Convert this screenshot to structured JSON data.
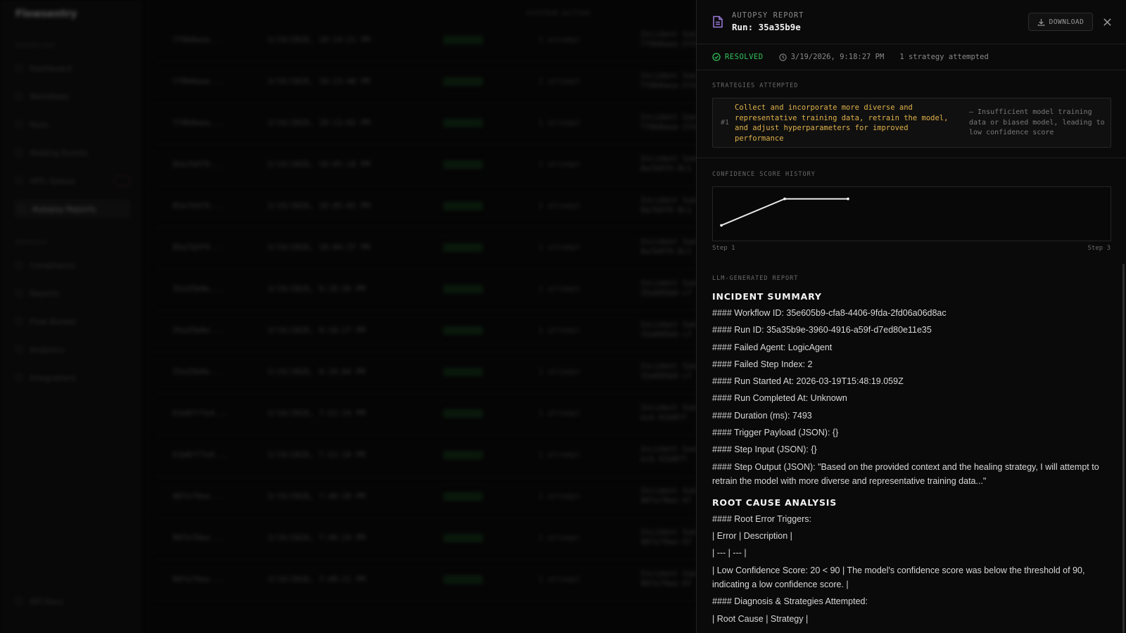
{
  "background": {
    "brand": "Flowsentry",
    "topbar": "SYSTEM ACTIVE",
    "sections": [
      "WORKFLOW",
      "ANALYSIS"
    ],
    "nav": [
      "Dashboard",
      "Workflows",
      "Runs",
      "Healing Events",
      "HITL Queue",
      "Autopsy Reports",
      "Compliance",
      "Reports",
      "Flow Builder",
      "Analytics",
      "Integrations"
    ],
    "footer": "API Docs",
    "rows": [
      {
        "id": "7f8b0aea...",
        "time": "3/19/2026, 10:14:21 PM",
        "attempts": "1 attempt",
        "detail1": "Incident Sum",
        "detail2": "7f8b0aea-2f4"
      },
      {
        "id": "7f8b0aea...",
        "time": "3/19/2026, 10:13:48 PM",
        "attempts": "1 attempt",
        "detail1": "Incident Sum",
        "detail2": "7f8b0aea-2f4"
      },
      {
        "id": "7f8b0aea...",
        "time": "3/19/2026, 10:13:02 PM",
        "attempts": "1 attempt",
        "detail1": "Incident Sum",
        "detail2": "7f8b0aea-2f4"
      },
      {
        "id": "85a7b9f9...",
        "time": "3/19/2026, 10:05:18 PM",
        "attempts": "1 attempt",
        "detail1": "Incident Sum",
        "detail2": "8a7b9f9-8c1"
      },
      {
        "id": "85a7b9f9...",
        "time": "3/19/2026, 10:05:02 PM",
        "attempts": "1 attempt",
        "detail1": "Incident Sum",
        "detail2": "8a7b9f9-8c1"
      },
      {
        "id": "85a7b9f9...",
        "time": "3/19/2026, 10:04:37 PM",
        "attempts": "1 attempt",
        "detail1": "Incident Sum",
        "detail2": "8a7b9f9-8c1"
      },
      {
        "id": "35a35b9e...",
        "time": "3/19/2026, 9:18:56 PM",
        "attempts": "1 attempt",
        "detail1": "Incident Sum",
        "detail2": "35e605b9-cf"
      },
      {
        "id": "35a35b9e...",
        "time": "3/19/2026, 9:18:27 PM",
        "attempts": "1 attempt",
        "detail1": "Incident Sum",
        "detail2": "35e605b9-cf"
      },
      {
        "id": "35a35b9e...",
        "time": "3/19/2026, 9:18:04 PM",
        "attempts": "1 attempt",
        "detail1": "Incident Sum",
        "detail2": "35e605b9-cf"
      },
      {
        "id": "61b8ff7e4...",
        "time": "3/19/2026, 7:52:14 PM",
        "attempts": "1 attempt",
        "detail1": "Incident Sum",
        "detail2": "ecb-61b8ff"
      },
      {
        "id": "61b8ff7e4...",
        "time": "3/19/2026, 7:52:18 PM",
        "attempts": "1 attempt",
        "detail1": "Incident Sum",
        "detail2": "ecb-61b8ff"
      },
      {
        "id": "907e79ee...",
        "time": "3/19/2026, 7:48:28 PM",
        "attempts": "1 attempt",
        "detail1": "Incident Sum",
        "detail2": "907e79ee-97"
      },
      {
        "id": "907e79ee...",
        "time": "3/19/2026, 7:48:24 PM",
        "attempts": "1 attempt",
        "detail1": "Incident Sum",
        "detail2": "907e79ee-97"
      },
      {
        "id": "907e79ee...",
        "time": "3/19/2026, 7:48:21 PM",
        "attempts": "1 attempt",
        "detail1": "Incident Sum",
        "detail2": "907e79ee-97"
      }
    ]
  },
  "header": {
    "kicker": "AUTOPSY REPORT",
    "title": "Run: 35a35b9e",
    "download_label": "DOWNLOAD"
  },
  "status": {
    "state": "RESOLVED",
    "timestamp": "3/19/2026, 9:18:27 PM",
    "strategy_count": "1 strategy attempted"
  },
  "strategies": {
    "label": "STRATEGIES ATTEMPTED",
    "items": [
      {
        "num": "#1",
        "text": "Collect and incorporate more diverse and representative training data, retrain the model, and adjust hyperparameters for improved performance",
        "cause": "— Insufficient model training data or biased model, leading to low confidence score"
      }
    ]
  },
  "confidence": {
    "label": "CONFIDENCE SCORE HISTORY",
    "axis_start": "Step 1",
    "axis_end": "Step 3"
  },
  "chart_data": {
    "type": "line",
    "x": [
      1,
      2,
      3
    ],
    "values": [
      20,
      85,
      85
    ],
    "ylim": [
      0,
      100
    ],
    "grid": false,
    "xlabel": "",
    "ylabel": ""
  },
  "report": {
    "label": "LLM-GENERATED REPORT",
    "sections": [
      {
        "heading": "INCIDENT SUMMARY",
        "lines": [
          "#### Workflow ID: 35e605b9-cfa8-4406-9fda-2fd06a06d8ac",
          "#### Run ID: 35a35b9e-3960-4916-a59f-d7ed80e11e35",
          "#### Failed Agent: LogicAgent",
          "#### Failed Step Index: 2",
          "#### Run Started At: 2026-03-19T15:48:19.059Z",
          "#### Run Completed At: Unknown",
          "#### Duration (ms): 7493",
          "#### Trigger Payload (JSON): {}",
          "#### Step Input (JSON): {}",
          "#### Step Output (JSON): \"Based on the provided context and the healing strategy, I will attempt to retrain the model with more diverse and representative training data...\""
        ]
      },
      {
        "heading": "ROOT CAUSE ANALYSIS",
        "lines": [
          "#### Root Error Triggers:",
          "| Error | Description |",
          "| --- | --- |",
          "| Low Confidence Score: 20 < 90 | The model's confidence score was below the threshold of 90, indicating a low confidence score. |",
          "#### Diagnosis & Strategies Attempted:",
          "| Root Cause | Strategy |"
        ]
      }
    ]
  },
  "colors": {
    "accent_resolved": "#33c15a",
    "strategy_text": "#e0b24a",
    "doc_icon": "#9b7bd8"
  }
}
